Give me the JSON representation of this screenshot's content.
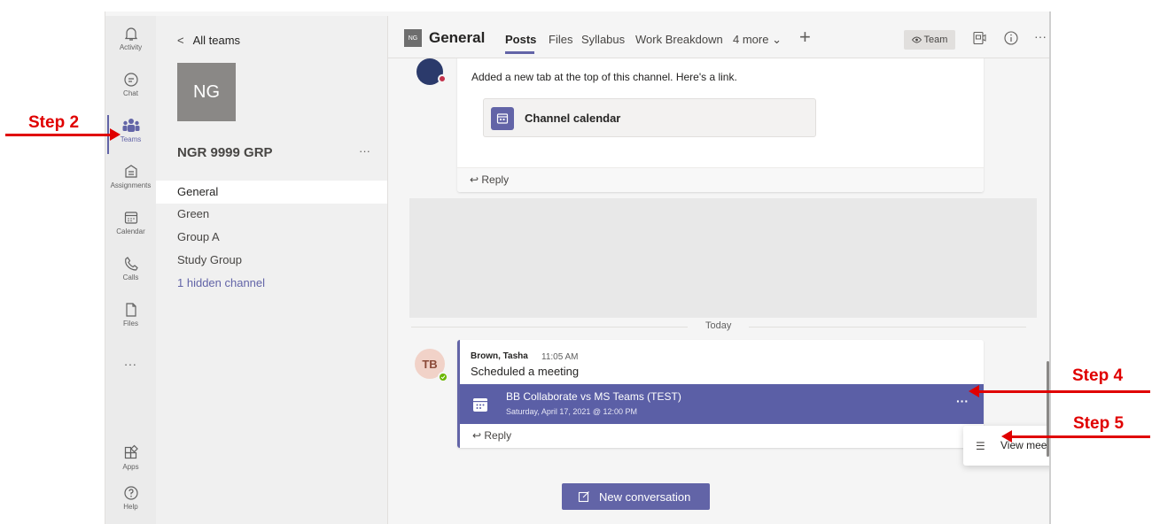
{
  "rail": {
    "items": [
      {
        "label": "Activity"
      },
      {
        "label": "Chat"
      },
      {
        "label": "Teams"
      },
      {
        "label": "Assignments"
      },
      {
        "label": "Calendar"
      },
      {
        "label": "Calls"
      },
      {
        "label": "Files"
      }
    ],
    "more": "...",
    "apps_label": "Apps",
    "help_label": "Help"
  },
  "panel": {
    "back_label": "All teams",
    "team_initials": "NG",
    "team_name": "NGR 9999 GRP",
    "team_more": "···",
    "channels": [
      {
        "label": "General"
      },
      {
        "label": "Green"
      },
      {
        "label": "Group A"
      },
      {
        "label": "Study Group"
      },
      {
        "label": "1 hidden channel"
      }
    ]
  },
  "header": {
    "avatar": "NG",
    "title": "General",
    "tabs": [
      {
        "label": "Posts"
      },
      {
        "label": "Files"
      },
      {
        "label": "Syllabus"
      },
      {
        "label": "Work Breakdown"
      },
      {
        "label": "4 more ⌄"
      }
    ],
    "plus": "+",
    "team_button": "Team",
    "more": "···"
  },
  "feed": {
    "post1": {
      "cutoff_text": "Added a new tab at the top of this channel. Here's a link.",
      "card_label": "Channel calendar",
      "reply": "Reply"
    },
    "today": "Today",
    "post2": {
      "initials": "TB",
      "author": "Brown, Tasha",
      "time": "11:05 AM",
      "text": "Scheduled a meeting",
      "meeting_title": "BB Collaborate vs MS Teams (TEST)",
      "meeting_date": "Saturday, April 17, 2021 @ 12:00 PM",
      "more": "···",
      "reply": "Reply"
    },
    "context_menu": {
      "label": "View meeting details"
    },
    "new_conversation": "New conversation"
  },
  "annotations": {
    "step2": "Step 2",
    "step4": "Step 4",
    "step5": "Step 5",
    "color": "#e00000"
  },
  "colors": {
    "accent": "#6264a7",
    "meeting_banner": "#5b5fa6"
  }
}
